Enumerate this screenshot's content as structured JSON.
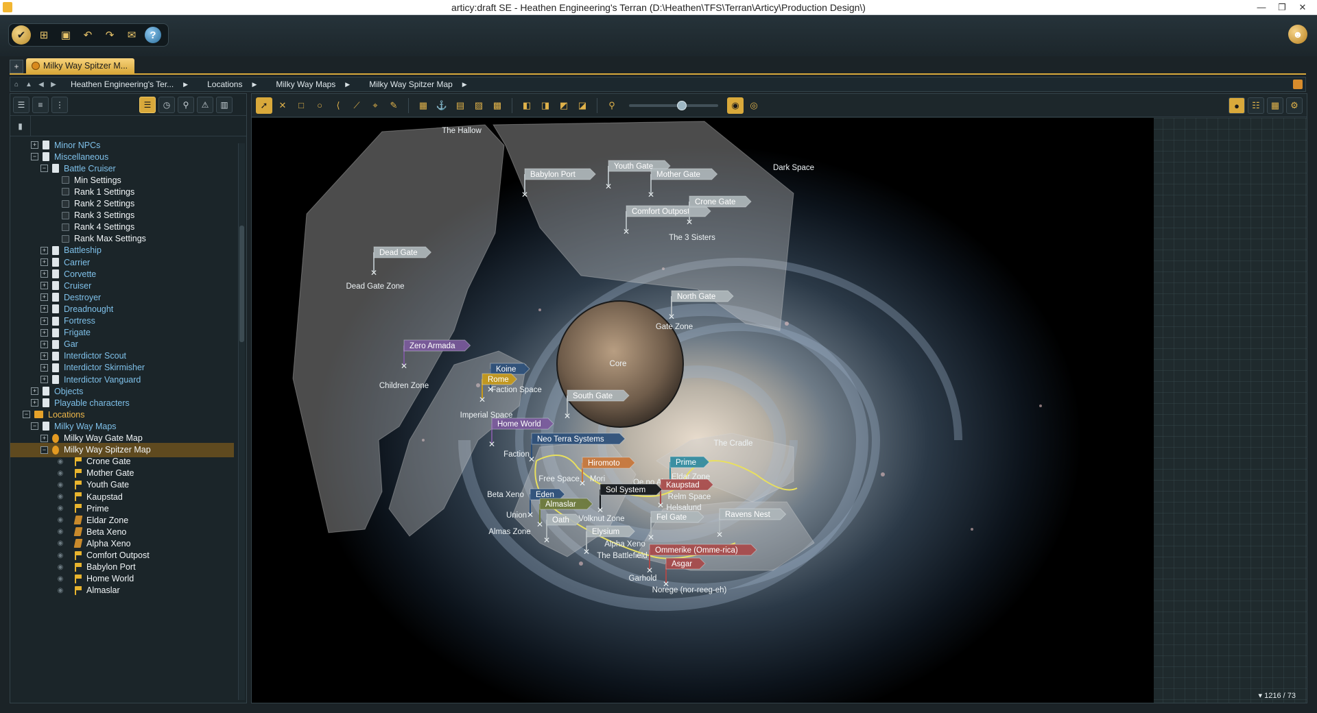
{
  "window": {
    "title": "articy:draft SE - Heathen Engineering's Terran (D:\\Heathen\\TFS\\Terran\\Articy\\Production Design\\)"
  },
  "tabs": [
    {
      "label": "Milky Way Spitzer M..."
    }
  ],
  "breadcrumb": [
    "Heathen Engineering's Ter...",
    "Locations",
    "Milky Way Maps",
    "Milky Way Spitzer Map"
  ],
  "tree": [
    {
      "label": "Minor NPCs",
      "level": 1,
      "exp": "+",
      "icon": "doc",
      "color": "blue"
    },
    {
      "label": "Miscellaneous",
      "level": 1,
      "exp": "-",
      "icon": "doc",
      "color": "blue"
    },
    {
      "label": "Battle Cruiser",
      "level": 2,
      "exp": "-",
      "icon": "doc",
      "color": "blue"
    },
    {
      "label": "Min Settings",
      "level": 3,
      "exp": "",
      "icon": "inst",
      "color": "white"
    },
    {
      "label": "Rank 1 Settings",
      "level": 3,
      "exp": "",
      "icon": "inst",
      "color": "white"
    },
    {
      "label": "Rank 2 Settings",
      "level": 3,
      "exp": "",
      "icon": "inst",
      "color": "white"
    },
    {
      "label": "Rank 3 Settings",
      "level": 3,
      "exp": "",
      "icon": "inst",
      "color": "white"
    },
    {
      "label": "Rank 4 Settings",
      "level": 3,
      "exp": "",
      "icon": "inst",
      "color": "white"
    },
    {
      "label": "Rank Max Settings",
      "level": 3,
      "exp": "",
      "icon": "inst",
      "color": "white"
    },
    {
      "label": "Battleship",
      "level": 2,
      "exp": "+",
      "icon": "doc",
      "color": "blue"
    },
    {
      "label": "Carrier",
      "level": 2,
      "exp": "+",
      "icon": "doc",
      "color": "blue"
    },
    {
      "label": "Corvette",
      "level": 2,
      "exp": "+",
      "icon": "doc",
      "color": "blue"
    },
    {
      "label": "Cruiser",
      "level": 2,
      "exp": "+",
      "icon": "doc",
      "color": "blue"
    },
    {
      "label": "Destroyer",
      "level": 2,
      "exp": "+",
      "icon": "doc",
      "color": "blue"
    },
    {
      "label": "Dreadnought",
      "level": 2,
      "exp": "+",
      "icon": "doc",
      "color": "blue"
    },
    {
      "label": "Fortress",
      "level": 2,
      "exp": "+",
      "icon": "doc",
      "color": "blue"
    },
    {
      "label": "Frigate",
      "level": 2,
      "exp": "+",
      "icon": "doc",
      "color": "blue"
    },
    {
      "label": "Gar",
      "level": 2,
      "exp": "+",
      "icon": "doc",
      "color": "blue"
    },
    {
      "label": "Interdictor Scout",
      "level": 2,
      "exp": "+",
      "icon": "doc",
      "color": "blue"
    },
    {
      "label": "Interdictor Skirmisher",
      "level": 2,
      "exp": "+",
      "icon": "doc",
      "color": "blue"
    },
    {
      "label": "Interdictor Vanguard",
      "level": 2,
      "exp": "+",
      "icon": "doc",
      "color": "blue"
    },
    {
      "label": "Objects",
      "level": 1,
      "exp": "+",
      "icon": "doc",
      "color": "blue"
    },
    {
      "label": "Playable characters",
      "level": 1,
      "exp": "+",
      "icon": "doc",
      "color": "blue"
    },
    {
      "label": "Locations",
      "level": 0,
      "exp": "-",
      "icon": "folder",
      "color": "loc"
    },
    {
      "label": "Milky Way Maps",
      "level": 1,
      "exp": "-",
      "icon": "doc",
      "color": "blue"
    },
    {
      "label": "Milky Way Gate Map",
      "level": 2,
      "exp": "+",
      "icon": "map",
      "color": "white"
    },
    {
      "label": "Milky Way Spitzer Map",
      "level": 2,
      "exp": "-",
      "icon": "map",
      "color": "white",
      "selected": true
    },
    {
      "label": "Crone Gate",
      "level": 3,
      "exp": "",
      "icon": "flag",
      "color": "white",
      "eye": true
    },
    {
      "label": "Mother Gate",
      "level": 3,
      "exp": "",
      "icon": "flag",
      "color": "white",
      "eye": true
    },
    {
      "label": "Youth Gate",
      "level": 3,
      "exp": "",
      "icon": "flag",
      "color": "white",
      "eye": true
    },
    {
      "label": "Kaupstad",
      "level": 3,
      "exp": "",
      "icon": "flag",
      "color": "white",
      "eye": true
    },
    {
      "label": "Prime",
      "level": 3,
      "exp": "",
      "icon": "flag",
      "color": "white",
      "eye": true
    },
    {
      "label": "Eldar Zone",
      "level": 3,
      "exp": "",
      "icon": "zone",
      "color": "white",
      "eye": true
    },
    {
      "label": "Beta Xeno",
      "level": 3,
      "exp": "",
      "icon": "zone",
      "color": "white",
      "eye": true
    },
    {
      "label": "Alpha Xeno",
      "level": 3,
      "exp": "",
      "icon": "zone",
      "color": "white",
      "eye": true
    },
    {
      "label": "Comfort Outpost",
      "level": 3,
      "exp": "",
      "icon": "flag",
      "color": "white",
      "eye": true
    },
    {
      "label": "Babylon Port",
      "level": 3,
      "exp": "",
      "icon": "flag",
      "color": "white",
      "eye": true
    },
    {
      "label": "Home World",
      "level": 3,
      "exp": "",
      "icon": "flag",
      "color": "white",
      "eye": true
    },
    {
      "label": "Almaslar",
      "level": 3,
      "exp": "",
      "icon": "flag",
      "color": "white",
      "eye": true
    }
  ],
  "map": {
    "zones": [
      "The Hallow",
      "Dark Space",
      "Dead Gate Zone",
      "Children Zone",
      "Core",
      "Gate Zone",
      "The 3 Sisters",
      "The Cradle",
      "Imperial Space",
      "Faction Space",
      "Faction",
      "Free Space",
      "Mori",
      "Oe no Al",
      "Eldar Zone",
      "Relm Space",
      "Helsalund",
      "Beta Xeno",
      "Union",
      "Almas Zone",
      "Volknut Zone",
      "Alpha Xeno",
      "The Battlefield",
      "Garhold",
      "Norege (nor-reeg-eh)"
    ],
    "pins": [
      {
        "label": "Babylon Port",
        "style": "gray"
      },
      {
        "label": "Youth Gate",
        "style": "gray"
      },
      {
        "label": "Mother Gate",
        "style": "gray"
      },
      {
        "label": "Comfort Outpost",
        "style": "gray"
      },
      {
        "label": "Crone Gate",
        "style": "gray"
      },
      {
        "label": "Dead Gate",
        "style": "gray"
      },
      {
        "label": "North Gate",
        "style": "gray"
      },
      {
        "label": "Zero Armada",
        "style": "purple"
      },
      {
        "label": "Koine",
        "style": "blue"
      },
      {
        "label": "Rome",
        "style": "gold"
      },
      {
        "label": "South Gate",
        "style": "gray"
      },
      {
        "label": "Home World",
        "style": "purple"
      },
      {
        "label": "Neo Terra Systems",
        "style": "blue"
      },
      {
        "label": "Hiromoto",
        "style": "orange"
      },
      {
        "label": "Prime",
        "style": "teal"
      },
      {
        "label": "Kaupstad",
        "style": "red"
      },
      {
        "label": "Sol System",
        "style": "dark"
      },
      {
        "label": "Eden",
        "style": "blue"
      },
      {
        "label": "Almaslar",
        "style": "olive"
      },
      {
        "label": "Oath",
        "style": "gray"
      },
      {
        "label": "Fel Gate",
        "style": "gray"
      },
      {
        "label": "Ravens Nest",
        "style": "gray"
      },
      {
        "label": "Elysium",
        "style": "gray"
      },
      {
        "label": "Ommerike (Omme-rica)",
        "style": "red"
      },
      {
        "label": "Asgar",
        "style": "red"
      }
    ]
  },
  "status": {
    "count": "1216 / 73"
  },
  "colors": {
    "accent": "#d9a93b",
    "tree_blue": "#7fc1ea",
    "selection": "#5f4a1f"
  }
}
